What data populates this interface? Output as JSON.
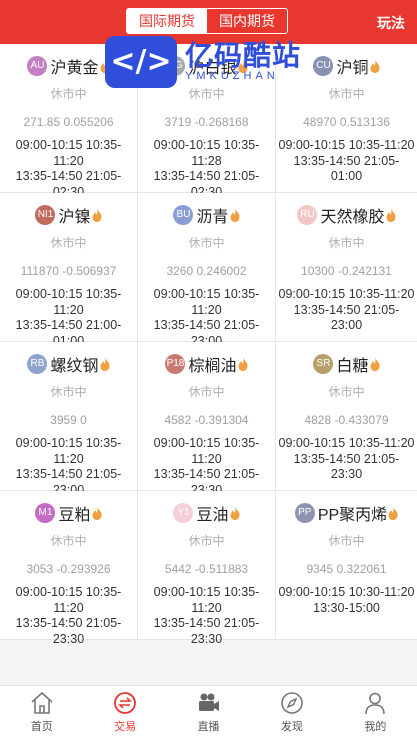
{
  "header": {
    "tabs": [
      {
        "label": "国际期货",
        "active": true
      },
      {
        "label": "国内期货",
        "active": false
      }
    ],
    "right_link": "玩法"
  },
  "watermark": {
    "title": "亿码酷站",
    "sub": "YMKUZHAN",
    "icon_text": "</>"
  },
  "colors": {
    "accent": "#e8372f",
    "watermark": "#2f4ed9"
  },
  "products": [
    {
      "code": "AU",
      "name": "沪黄金",
      "badge_color": "#c37fc3",
      "status": "休市中",
      "quote": "271.85 0.055206",
      "hours": [
        "09:00-10:15 10:35-11:20",
        "13:35-14:50 21:05-",
        "02:30"
      ]
    },
    {
      "code": "AG",
      "name": "沪白银",
      "badge_color": "#a7a7a7",
      "status": "休市中",
      "quote": "3719 -0.268168",
      "hours": [
        "09:00-10:15 10:35-11:28",
        "13:35-14:50 21:05-",
        "02:30"
      ]
    },
    {
      "code": "CU",
      "name": "沪铜",
      "badge_color": "#8891b4",
      "status": "休市中",
      "quote": "48970 0.513136",
      "hours": [
        "09:00-10:15 10:35-11:20",
        "13:35-14:50 21:05-",
        "01:00"
      ]
    },
    {
      "code": "NI1",
      "name": "沪镍",
      "badge_color": "#c06a60",
      "status": "休市中",
      "quote": "111870 -0.506937",
      "hours": [
        "09:00-10:15 10:35-11:20",
        "13:35-14:50 21:00-",
        "01:00"
      ]
    },
    {
      "code": "BU",
      "name": "沥青",
      "badge_color": "#8a9ed6",
      "status": "休市中",
      "quote": "3260 0.246002",
      "hours": [
        "09:00-10:15 10:35-11:20",
        "13:35-14:50 21:05-",
        "23:00"
      ]
    },
    {
      "code": "RU",
      "name": "天然橡胶",
      "badge_color": "#f2c8c6",
      "status": "休市中",
      "quote": "10300 -0.242131",
      "hours": [
        "09:00-10:15 10:35-11:20",
        "13:35-14:50 21:05-",
        "23:00"
      ]
    },
    {
      "code": "RB",
      "name": "螺纹钢",
      "badge_color": "#8ea4cf",
      "status": "休市中",
      "quote": "3959 0",
      "hours": [
        "09:00-10:15 10:35-11:20",
        "13:35-14:50 21:05-",
        "23:00"
      ]
    },
    {
      "code": "P18",
      "name": "棕榈油",
      "badge_color": "#c97a70",
      "status": "休市中",
      "quote": "4582 -0.391304",
      "hours": [
        "09:00-10:15 10:35-11:20",
        "13:35-14:50 21:05-",
        "23:30"
      ]
    },
    {
      "code": "SR",
      "name": "白糖",
      "badge_color": "#b8a06a",
      "status": "休市中",
      "quote": "4828 -0.433079",
      "hours": [
        "09:00-10:15 10:35-11:20",
        "13:35-14:50 21:05-",
        "23:30"
      ]
    },
    {
      "code": "M1",
      "name": "豆粕",
      "badge_color": "#c56ac5",
      "status": "休市中",
      "quote": "3053 -0.293926",
      "hours": [
        "09:00-10:15 10:35-11:20",
        "13:35-14:50 21:05-",
        "23:30"
      ]
    },
    {
      "code": "Y1",
      "name": "豆油",
      "badge_color": "#f3cfd6",
      "status": "休市中",
      "quote": "5442 -0.511883",
      "hours": [
        "09:00-10:15 10:35-11:20",
        "13:35-14:50 21:05-",
        "23:30"
      ]
    },
    {
      "code": "PP",
      "name": "PP聚丙烯",
      "badge_color": "#8e93b2",
      "status": "休市中",
      "quote": "9345 0.322061",
      "hours": [
        "09:00-10:15 10:30-11:20",
        "13:30-15:00",
        ""
      ]
    }
  ],
  "tabbar": [
    {
      "label": "首页",
      "icon": "home-icon",
      "active": false
    },
    {
      "label": "交易",
      "icon": "trade-icon",
      "active": true
    },
    {
      "label": "直播",
      "icon": "camera-icon",
      "active": false
    },
    {
      "label": "发现",
      "icon": "compass-icon",
      "active": false
    },
    {
      "label": "我的",
      "icon": "user-icon",
      "active": false
    }
  ]
}
